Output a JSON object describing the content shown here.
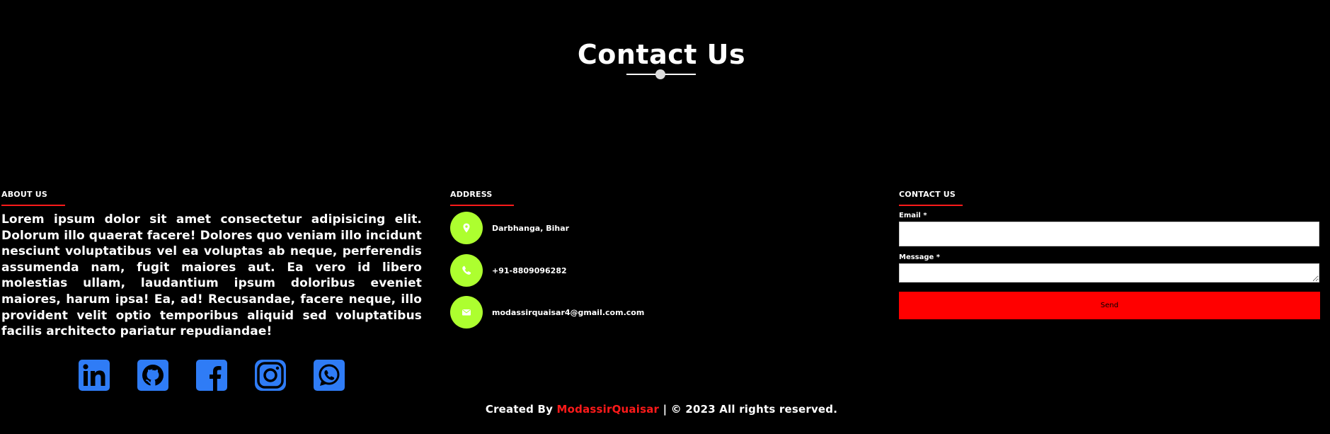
{
  "header": {
    "title": "Contact Us"
  },
  "about": {
    "heading": "ABOUT US",
    "text": "Lorem ipsum dolor sit amet consectetur adipisicing elit. Dolorum illo quaerat facere! Dolores quo veniam illo incidunt nesciunt voluptatibus vel ea voluptas ab neque, perferendis assumenda nam, fugit maiores aut. Ea vero id libero molestias ullam, laudantium ipsum doloribus eveniet maiores, harum ipsa! Ea, ad! Recusandae, facere neque, illo provident velit optio temporibus aliquid sed voluptatibus facilis architecto pariatur repudiandae!"
  },
  "social": {
    "items": [
      {
        "name": "linkedin-icon"
      },
      {
        "name": "github-icon"
      },
      {
        "name": "facebook-icon"
      },
      {
        "name": "instagram-icon"
      },
      {
        "name": "whatsapp-icon"
      }
    ],
    "color": "#2f7cf6"
  },
  "address": {
    "heading": "ADDRESS",
    "items": [
      {
        "icon": "location-pin-icon",
        "text": "Darbhanga, Bihar"
      },
      {
        "icon": "phone-icon",
        "text": "+91-8809096282"
      },
      {
        "icon": "envelope-icon",
        "text": "modassirquaisar4@gmail.com.com"
      }
    ],
    "circle_color": "#adff2f"
  },
  "contact_form": {
    "heading": "CONTACT US",
    "email_label": "Email *",
    "email_value": "",
    "message_label": "Message *",
    "message_value": "",
    "send_label": "Send",
    "button_color": "#ff0000"
  },
  "footer": {
    "prefix": "Created By",
    "author": "ModassirQuaisar",
    "suffix": "| © 2023 All rights reserved."
  },
  "colors": {
    "background": "#000000",
    "accent": "#ff1a1a"
  }
}
